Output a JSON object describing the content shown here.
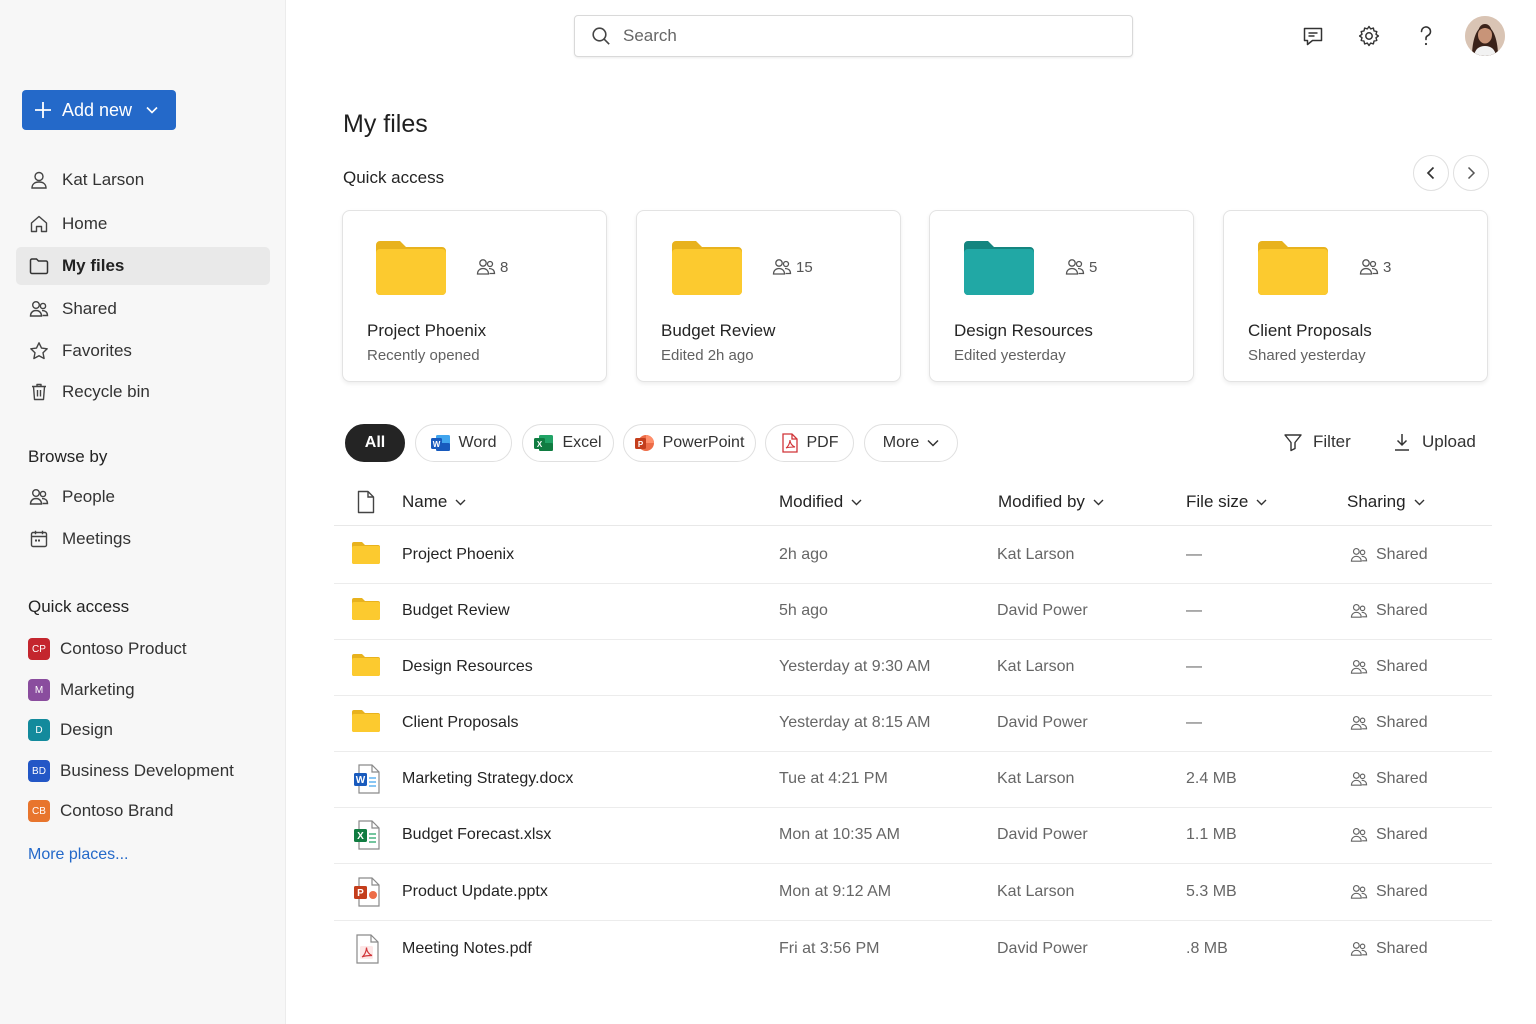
{
  "sidebar": {
    "add_new_label": "Add new",
    "nav": [
      {
        "label": "Kat Larson",
        "icon": "person-icon"
      },
      {
        "label": "Home",
        "icon": "home-icon"
      },
      {
        "label": "My files",
        "icon": "folder-icon",
        "active": true
      },
      {
        "label": "Shared",
        "icon": "people-icon"
      },
      {
        "label": "Favorites",
        "icon": "star-icon"
      },
      {
        "label": "Recycle bin",
        "icon": "trash-icon"
      }
    ],
    "browse_by_title": "Browse by",
    "browse": [
      {
        "label": "People",
        "icon": "people-icon"
      },
      {
        "label": "Meetings",
        "icon": "calendar-icon"
      }
    ],
    "quick_access_title": "Quick access",
    "quick_access": [
      {
        "badge": "CP",
        "label": "Contoso Product",
        "color": "#c4262e"
      },
      {
        "badge": "M",
        "label": "Marketing",
        "color": "#8a4d9e"
      },
      {
        "badge": "D",
        "label": "Design",
        "color": "#138a9c"
      },
      {
        "badge": "BD",
        "label": "Business Development",
        "color": "#2357c6"
      },
      {
        "badge": "CB",
        "label": "Contoso Brand",
        "color": "#e8752d"
      }
    ],
    "more_places": "More places..."
  },
  "topbar": {
    "search_placeholder": "Search",
    "icons": [
      "feedback-icon",
      "settings-icon",
      "help-icon",
      "avatar"
    ]
  },
  "main": {
    "title": "My files",
    "quick_access_title": "Quick access",
    "cards": [
      {
        "name": "Project Phoenix",
        "subtitle": "Recently opened",
        "members": "8",
        "folder_color": "#fcca2f"
      },
      {
        "name": "Budget Review",
        "subtitle": "Edited 2h ago",
        "members": "15",
        "folder_color": "#fcca2f"
      },
      {
        "name": "Design Resources",
        "subtitle": "Edited yesterday",
        "members": "5",
        "folder_color": "#21a8a5"
      },
      {
        "name": "Client Proposals",
        "subtitle": "Shared yesterday",
        "members": "3",
        "folder_color": "#fcca2f"
      }
    ],
    "filters": {
      "all": "All",
      "word": "Word",
      "excel": "Excel",
      "powerpoint": "PowerPoint",
      "pdf": "PDF",
      "more": "More"
    },
    "filter_label": "Filter",
    "upload_label": "Upload",
    "columns": {
      "name": "Name",
      "modified": "Modified",
      "modified_by": "Modified by",
      "file_size": "File size",
      "sharing": "Sharing"
    },
    "rows": [
      {
        "type": "folder",
        "name": "Project Phoenix",
        "modified": "2h ago",
        "by": "Kat Larson",
        "size": "—",
        "sharing": "Shared"
      },
      {
        "type": "folder",
        "name": "Budget Review",
        "modified": "5h ago",
        "by": "David Power",
        "size": "—",
        "sharing": "Shared"
      },
      {
        "type": "folder",
        "name": "Design Resources",
        "modified": "Yesterday at 9:30 AM",
        "by": "Kat Larson",
        "size": "—",
        "sharing": "Shared"
      },
      {
        "type": "folder",
        "name": "Client Proposals",
        "modified": "Yesterday at 8:15 AM",
        "by": "David Power",
        "size": "—",
        "sharing": "Shared"
      },
      {
        "type": "word",
        "name": "Marketing Strategy.docx",
        "modified": "Tue at 4:21 PM",
        "by": "Kat Larson",
        "size": "2.4 MB",
        "sharing": "Shared"
      },
      {
        "type": "excel",
        "name": "Budget Forecast.xlsx",
        "modified": "Mon at 10:35 AM",
        "by": "David Power",
        "size": "1.1 MB",
        "sharing": "Shared"
      },
      {
        "type": "powerpoint",
        "name": "Product Update.pptx",
        "modified": "Mon at 9:12 AM",
        "by": "Kat Larson",
        "size": "5.3 MB",
        "sharing": "Shared"
      },
      {
        "type": "pdf",
        "name": "Meeting Notes.pdf",
        "modified": "Fri at 3:56 PM",
        "by": "David Power",
        "size": ".8 MB",
        "sharing": "Shared"
      }
    ]
  }
}
